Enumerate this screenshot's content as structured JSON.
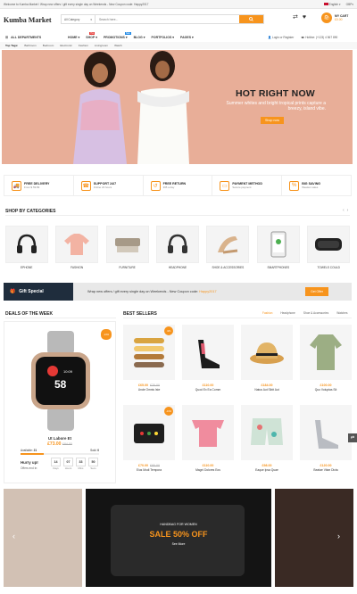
{
  "topbar": {
    "welcome": "Welcome to Kumba Market ! Wrap new offers / gift every single day on Weekends - New Coupon code: Happy2017",
    "language": "English",
    "currency": "GBP"
  },
  "header": {
    "logo": "Kumba Market",
    "category": "All Category",
    "search_placeholder": "Search here...",
    "cart_label": "MY CART",
    "cart_total": "£0.00"
  },
  "nav": {
    "departments": "ALL DEPARTMENTS",
    "items": [
      {
        "label": "HOME",
        "badge": ""
      },
      {
        "label": "SHOP",
        "badge": "Hot"
      },
      {
        "label": "PROMOTIONS",
        "badge": "Sale"
      },
      {
        "label": "BLOG",
        "badge": ""
      },
      {
        "label": "PORTFOLIOS",
        "badge": ""
      },
      {
        "label": "PAGES",
        "badge": ""
      }
    ],
    "login": "Login or Register",
    "hotline": "Hotline: (+123) 4 567 890"
  },
  "tags": {
    "label": "Top Tags:",
    "items": [
      "Bathroom",
      "Bedroom",
      "Electronic",
      "Fashion",
      "Livingroom",
      "Watch"
    ]
  },
  "hero": {
    "title": "HOT RIGHT NOW",
    "subtitle": "Summer whites and bright tropical prints capture a breezy, island vibe.",
    "button": "Shop now"
  },
  "features": [
    {
      "title": "FREE DELIVERY",
      "sub": "From $ 59.89",
      "icon": "truck-icon"
    },
    {
      "title": "SUPPORT 24/7",
      "sub": "Online 24 hours",
      "icon": "support-icon"
    },
    {
      "title": "FREE RETURN",
      "sub": "365 a day",
      "icon": "return-icon"
    },
    {
      "title": "PAYMENT METHOD",
      "sub": "Secure payment",
      "icon": "card-icon"
    },
    {
      "title": "BIG SAVING",
      "sub": "Weeken sales",
      "icon": "saving-icon"
    }
  ],
  "categories": {
    "title": "SHOP BY CATEGORIES",
    "items": [
      "EPHONE",
      "FASHION",
      "FURNITURE",
      "HEADPHONE",
      "SHOE & ACCESSORIES",
      "SMARTPHONES",
      "TOWELS COULD"
    ]
  },
  "gift": {
    "label": "Gift Special",
    "message": "Wrap new offers / gift every single day on Weekends - New Coupon code:",
    "code": "Happy2017",
    "button": "Get Offer"
  },
  "deals": {
    "title": "DEALS OF THE WEEK",
    "sale": "-13%",
    "watch_time": "10:09",
    "watch_big": "58",
    "name": "Ut Labore Et",
    "price": "£73.00",
    "old_price": "£84.00",
    "available_label": "Available:",
    "available": "21",
    "sold_label": "Sold:",
    "sold": "0",
    "hurry": "Hurry up!",
    "offers_end": "Offers end in:",
    "countdown": [
      {
        "v": "14",
        "u": "Days"
      },
      {
        "v": "07",
        "u": "Hours"
      },
      {
        "v": "33",
        "u": "Mins"
      },
      {
        "v": "50",
        "u": "Secs"
      }
    ]
  },
  "best": {
    "title": "BEST SELLERS",
    "tabs": [
      "Fashion",
      "Headphone",
      "Shoe & Accessories",
      "Watches"
    ],
    "products": [
      {
        "price": "£65.00",
        "old": "£70.00",
        "name": "Unde Omnis Iste",
        "sale": "-9%"
      },
      {
        "price": "£110.00",
        "old": "",
        "name": "Quod Ex Ea Comm",
        "sale": ""
      },
      {
        "price": "£184.00",
        "old": "",
        "name": "Natus Aut Sibit Aut",
        "sale": ""
      },
      {
        "price": "£100.00",
        "old": "",
        "name": "Quo Voluptas Sit",
        "sale": ""
      },
      {
        "price": "£70.00",
        "old": "£80.00",
        "name": "Eius Modi Tempora",
        "sale": "-13%"
      },
      {
        "price": "£110.00",
        "old": "",
        "name": "Magni Dolores Eos",
        "sale": ""
      },
      {
        "price": "£98.00",
        "old": "",
        "name": "Eaque Ipsa Quae",
        "sale": ""
      },
      {
        "price": "£120.00",
        "old": "",
        "name": "Beatae Vitae Dicta",
        "sale": ""
      }
    ]
  },
  "banner": {
    "kicker": "HANDBAG FOR WOMEN",
    "headline": "SALE 50% OFF",
    "link": "See More"
  },
  "colors": {
    "accent": "#f7941d",
    "dark": "#1f2d3d",
    "hero_bg": "#e8ae98"
  }
}
